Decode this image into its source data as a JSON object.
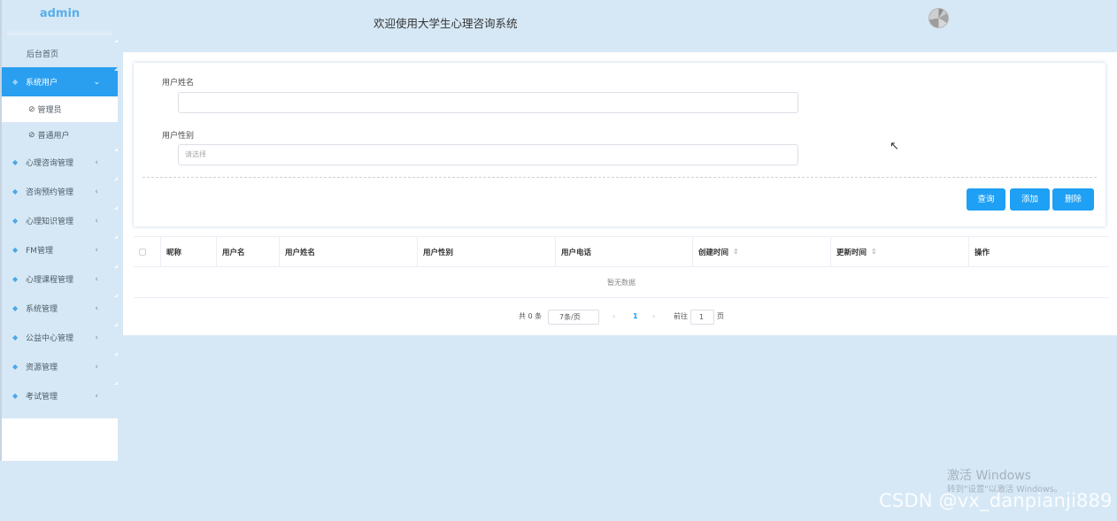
{
  "sidebar": {
    "brand": "admin",
    "home": "后台首页",
    "active_menu": "系统用户",
    "sub_items": [
      "管理员",
      "普通用户"
    ],
    "menus": [
      "心理咨询管理",
      "咨询预约管理",
      "心理知识管理",
      "FM管理",
      "心理课程管理",
      "系统管理",
      "公益中心管理",
      "资源管理",
      "考试管理"
    ]
  },
  "header": {
    "title": "欢迎使用大学生心理咨询系统"
  },
  "search": {
    "name_label": "用户姓名",
    "name_value": "",
    "gender_label": "用户性别",
    "gender_placeholder": "请选择",
    "buttons": {
      "query": "查询",
      "add": "添加",
      "delete": "删除"
    }
  },
  "table": {
    "columns": [
      "昵称",
      "用户名",
      "用户姓名",
      "用户性别",
      "用户电话",
      "创建时间",
      "更新时间",
      "操作"
    ],
    "empty_text": "暂无数据"
  },
  "pagination": {
    "total": "共 0 条",
    "page_size": "7条/页",
    "current_page": "1",
    "goto_label": "前往",
    "goto_value": "1",
    "page_unit": "页"
  },
  "watermarks": {
    "activate_title": "激活 Windows",
    "activate_hint": "转到\"设置\"以激活 Windows。",
    "csdn": "CSDN @vx_danpianji889"
  },
  "colors": {
    "accent": "#1ea0f4",
    "background": "#d6e8f6"
  }
}
